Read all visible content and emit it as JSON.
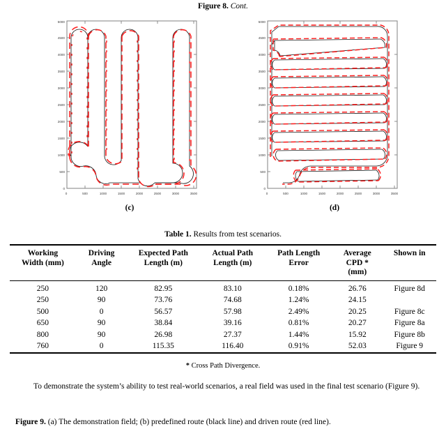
{
  "document": {
    "figure_cont": {
      "bold": "Figure 8.",
      "italic": "Cont."
    },
    "table_title": {
      "bold": "Table 1.",
      "rest": " Results from test scenarios."
    },
    "table_note": {
      "star": "*",
      "text": " Cross Path Divergence."
    },
    "paragraph": "To demonstrate the system’s ability to test real-world scenarios, a real field was used in the final test scenario (Figure 9).",
    "figure9_caption": {
      "bold": "Figure 9.",
      "rest": " (a) The demonstration field; (b) predefined route (black line) and driven route (red line)."
    }
  },
  "figures": {
    "subcaption_c": "(c)",
    "subcaption_d": "(d)",
    "colors": {
      "predefined_route": "#1a1a1a",
      "driven_route": "#ff1a1a",
      "axis": "#808080",
      "tick_label": "#3a3a3a"
    },
    "panel_c": {
      "label": "(c)",
      "x_ticks": [
        "0",
        "500",
        "1000",
        "1500",
        "2000",
        "2500",
        "3000",
        "3500"
      ],
      "y_ticks": [
        "0",
        "500",
        "1000",
        "1500",
        "2000",
        "2500",
        "3000",
        "3500",
        "4000",
        "4500",
        "5000"
      ],
      "xlim": [
        0,
        3500
      ],
      "ylim": [
        0,
        5000
      ],
      "working_width_mm": 500,
      "driving_angle_deg": 0
    },
    "panel_d": {
      "label": "(d)",
      "x_ticks": [
        "0",
        "500",
        "1000",
        "1500",
        "2000",
        "2500",
        "3000",
        "3500"
      ],
      "y_ticks": [
        "0",
        "500",
        "1000",
        "1500",
        "2000",
        "2500",
        "3000",
        "3500",
        "4000",
        "4500",
        "5000"
      ],
      "xlim": [
        0,
        3500
      ],
      "ylim": [
        0,
        5000
      ],
      "working_width_mm": 250,
      "driving_angle_deg": 120
    }
  },
  "table": {
    "headers": [
      "Working Width (mm)",
      "Driving Angle",
      "Expected Path Length (m)",
      "Actual Path Length (m)",
      "Path Length Error",
      "Average CPD * (mm)",
      "Shown in"
    ],
    "headers_lines": [
      [
        "Working",
        "Width (mm)"
      ],
      [
        "Driving",
        "Angle"
      ],
      [
        "Expected Path",
        "Length (m)"
      ],
      [
        "Actual Path",
        "Length (m)"
      ],
      [
        "Path Length",
        "Error"
      ],
      [
        "Average",
        "CPD *",
        "(mm)"
      ],
      [
        "Shown in"
      ]
    ],
    "rows": [
      {
        "working_width": "250",
        "driving_angle": "120",
        "expected_length": "82.95",
        "actual_length": "83.10",
        "length_error": "0.18%",
        "avg_cpd": "26.76",
        "shown_in": "Figure 8d"
      },
      {
        "working_width": "250",
        "driving_angle": "90",
        "expected_length": "73.76",
        "actual_length": "74.68",
        "length_error": "1.24%",
        "avg_cpd": "24.15",
        "shown_in": ""
      },
      {
        "working_width": "500",
        "driving_angle": "0",
        "expected_length": "56.57",
        "actual_length": "57.98",
        "length_error": "2.49%",
        "avg_cpd": "20.25",
        "shown_in": "Figure 8c"
      },
      {
        "working_width": "650",
        "driving_angle": "90",
        "expected_length": "38.84",
        "actual_length": "39.16",
        "length_error": "0.81%",
        "avg_cpd": "20.27",
        "shown_in": "Figure 8a"
      },
      {
        "working_width": "800",
        "driving_angle": "90",
        "expected_length": "26.98",
        "actual_length": "27.37",
        "length_error": "1.44%",
        "avg_cpd": "15.92",
        "shown_in": "Figure 8b"
      },
      {
        "working_width": "760",
        "driving_angle": "0",
        "expected_length": "115.35",
        "actual_length": "116.40",
        "length_error": "0.91%",
        "avg_cpd": "52.03",
        "shown_in": "Figure 9"
      }
    ]
  }
}
